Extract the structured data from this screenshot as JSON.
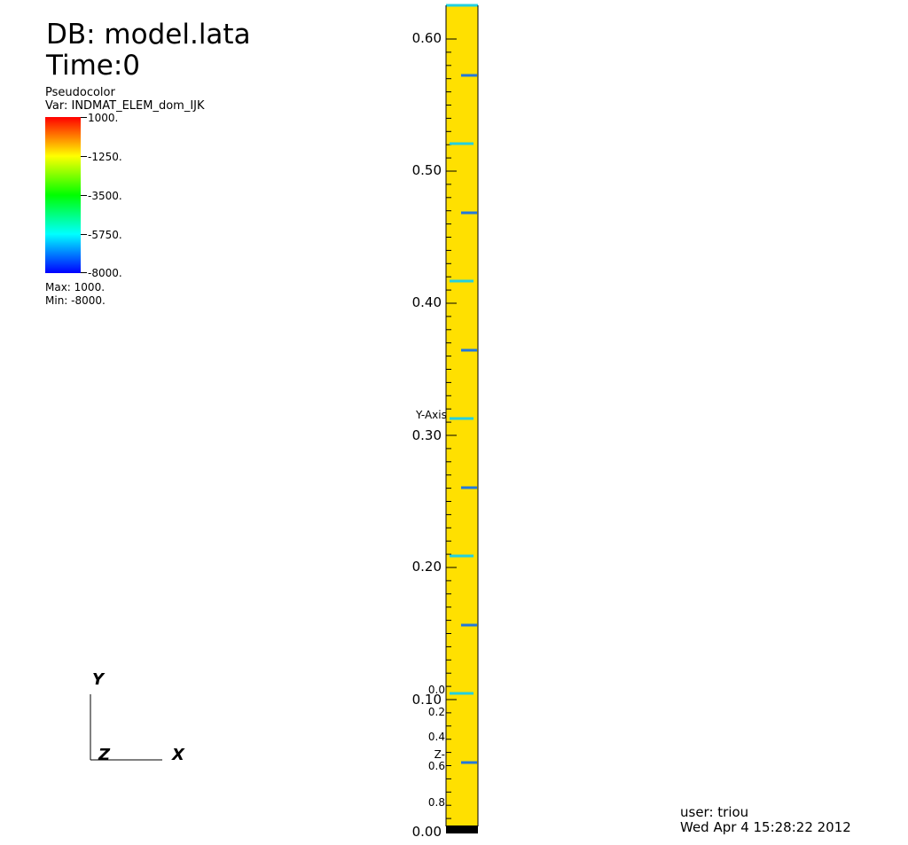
{
  "title": {
    "db": "DB: model.lata",
    "time": "Time:0"
  },
  "legend": {
    "plot_type": "Pseudocolor",
    "variable": "Var: INDMAT_ELEM_dom_IJK",
    "ticks": [
      "1000.",
      "-1250.",
      "-3500.",
      "-5750.",
      "-8000."
    ],
    "max": "Max:  1000.",
    "min": "Min: -8000.",
    "colors": [
      "#0000ff",
      "#00ffff",
      "#00ff00",
      "#ffff00",
      "#ff0000"
    ]
  },
  "axes": {
    "y_title": "Y-Axis",
    "y_ticks": [
      "0.60",
      "0.50",
      "0.40",
      "0.30",
      "0.20",
      "0.10",
      "0.00"
    ],
    "z_ticks": [
      "0.0",
      "0.2",
      "0.4",
      "0.6",
      "0.8"
    ],
    "z_label": "Z-"
  },
  "triad": {
    "x": "X",
    "y": "Y",
    "z": "Z"
  },
  "footer": {
    "user": "user: triou",
    "date": "Wed Apr  4 15:28:22 2012"
  },
  "colors": {
    "field": "#ffe000",
    "cyan_edge": "#22d0e0",
    "blue_dash": "#2277dd"
  }
}
